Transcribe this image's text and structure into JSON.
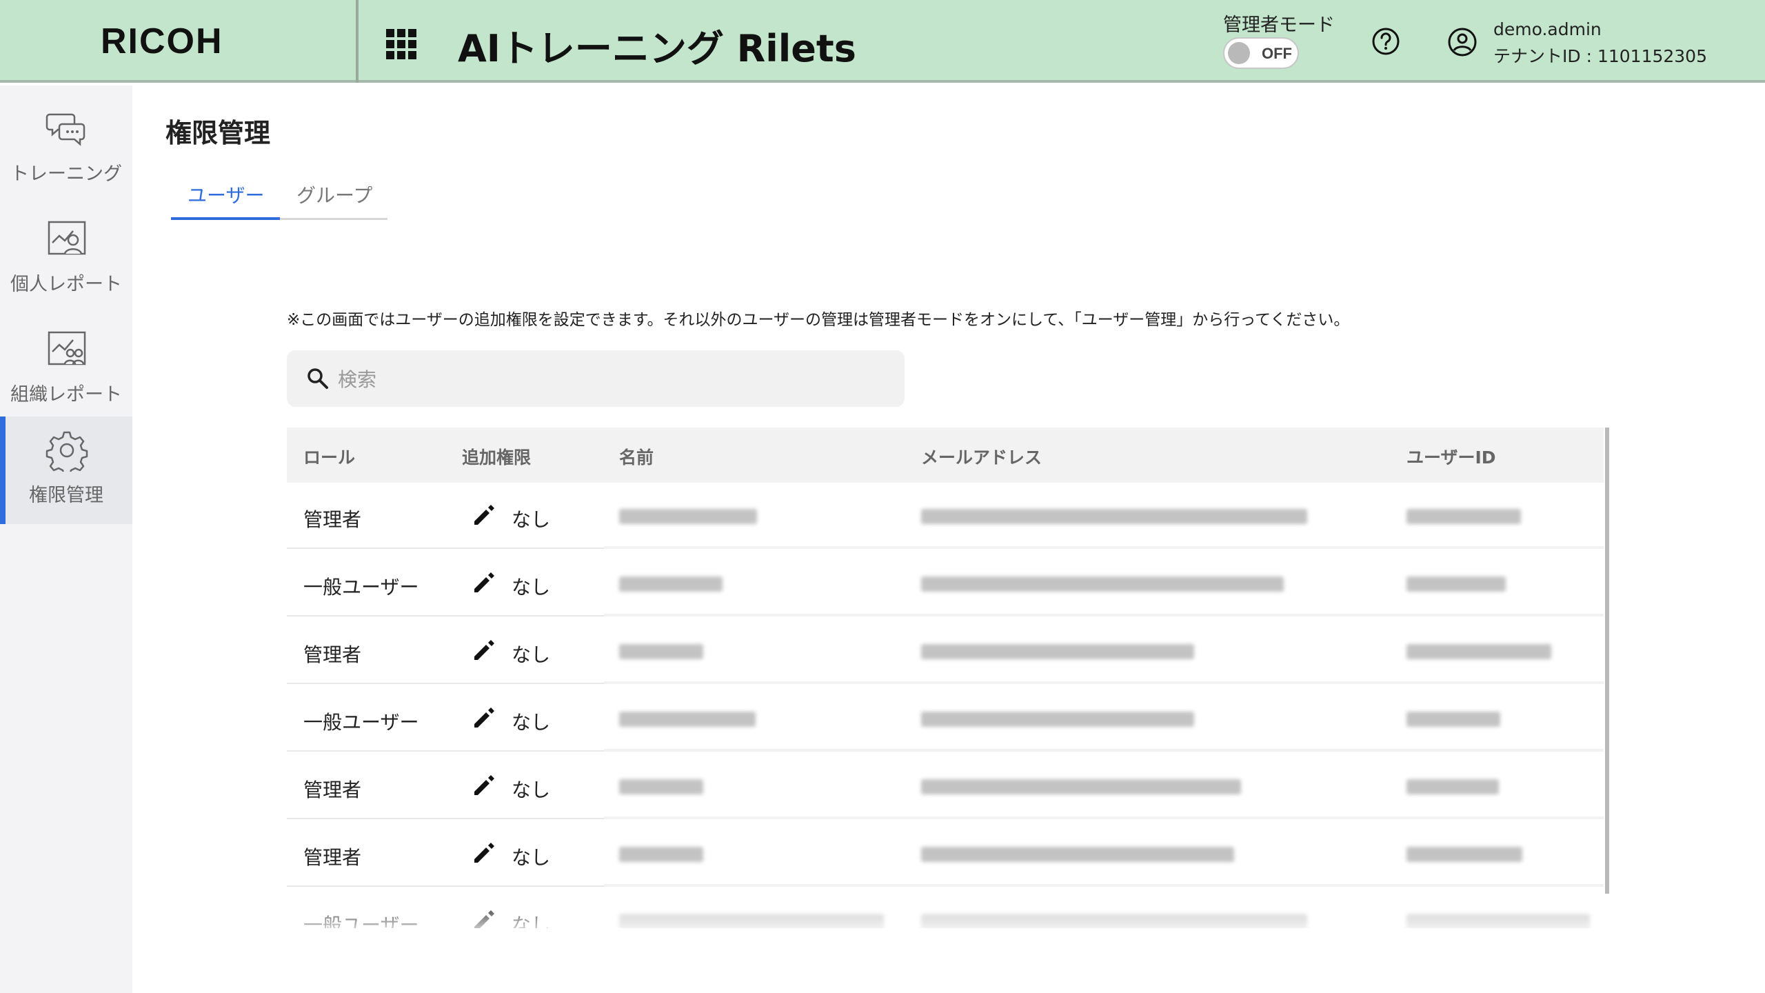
{
  "header": {
    "logo": "RICOH",
    "app_title": "AIトレーニング Rilets",
    "admin_mode_label": "管理者モード",
    "admin_mode_toggle": "OFF",
    "user_name": "demo.admin",
    "tenant": "テナントID : 1101152305",
    "icons": [
      "apps-grid-icon",
      "help-icon",
      "account-circle-icon"
    ]
  },
  "sidebar": {
    "items": [
      {
        "label": "トレーニング",
        "icon": "chat-bubbles-icon"
      },
      {
        "label": "個人レポート",
        "icon": "personal-report-icon"
      },
      {
        "label": "組織レポート",
        "icon": "organization-report-icon"
      },
      {
        "label": "権限管理",
        "icon": "gear-icon",
        "active": true
      }
    ]
  },
  "main": {
    "page_title": "権限管理",
    "tabs": [
      {
        "label": "ユーザー",
        "active": true
      },
      {
        "label": "グループ",
        "active": false
      }
    ],
    "notice": "※この画面ではユーザーの追加権限を設定できます。それ以外のユーザーの管理は管理者モードをオンにして、「ユーザー管理」から行ってください。",
    "search": {
      "placeholder": "検索",
      "value": ""
    },
    "table": {
      "columns": [
        "ロール",
        "追加権限",
        "名前",
        "メールアドレス",
        "ユーザーID"
      ],
      "rows": [
        {
          "role": "管理者",
          "permission": "なし"
        },
        {
          "role": "一般ユーザー",
          "permission": "なし"
        },
        {
          "role": "管理者",
          "permission": "なし"
        },
        {
          "role": "一般ユーザー",
          "permission": "なし"
        },
        {
          "role": "管理者",
          "permission": "なし"
        },
        {
          "role": "管理者",
          "permission": "なし"
        },
        {
          "role": "一般ユーザー",
          "permission": "なし"
        }
      ]
    }
  },
  "colors": {
    "header_bg": "#c2e5cb",
    "accent": "#2f6ddf",
    "sidebar_bg": "#f3f3f5"
  }
}
